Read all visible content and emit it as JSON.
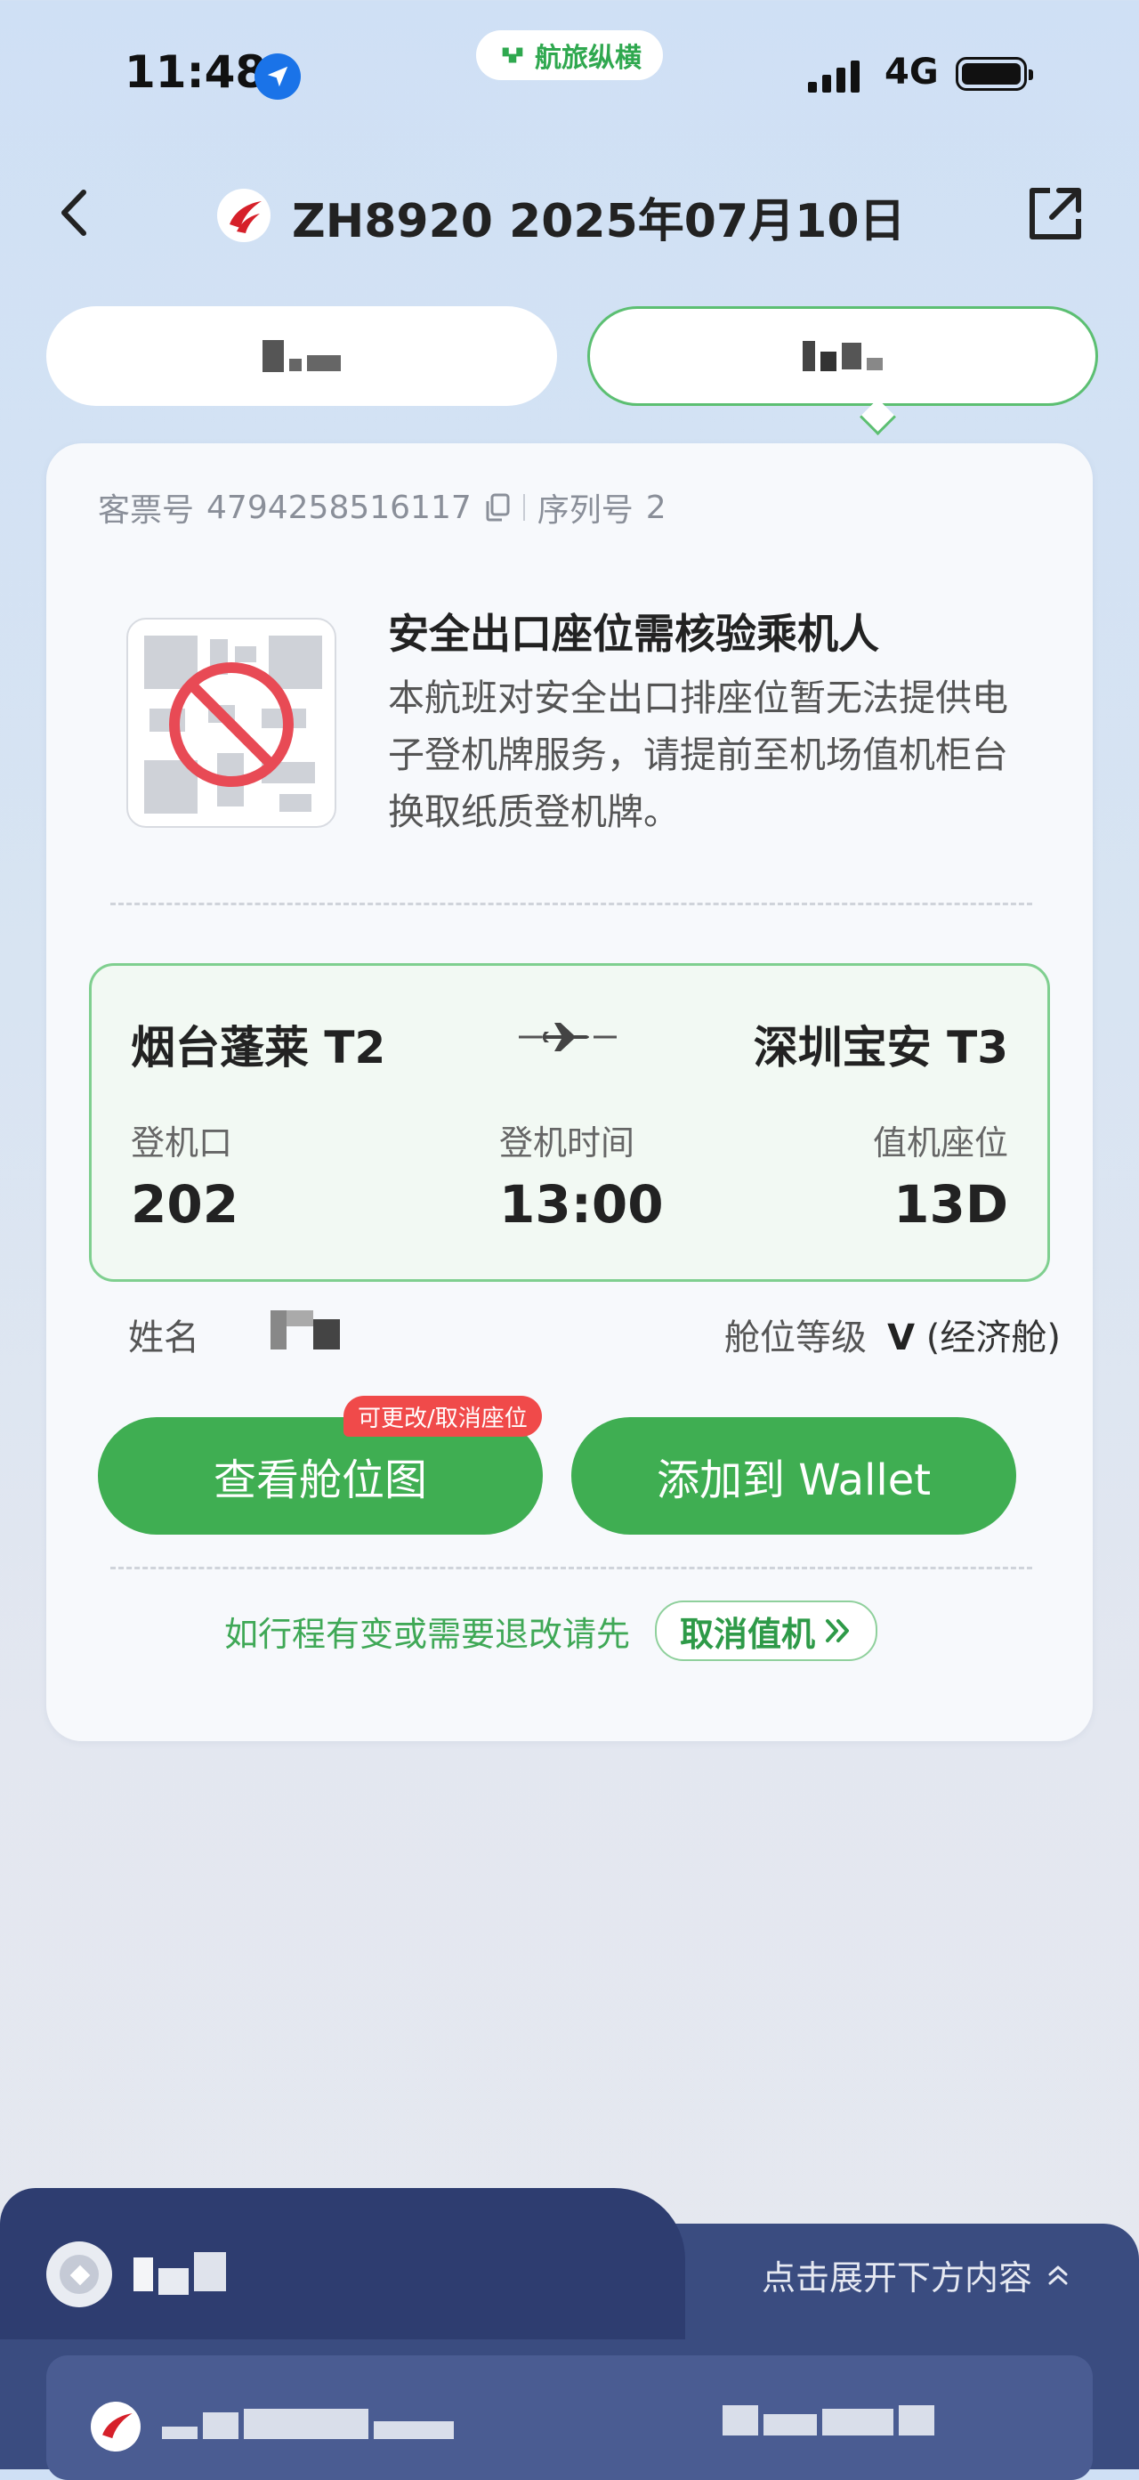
{
  "status_bar": {
    "time": "11:48",
    "app_badge": "航旅纵横",
    "network": "4G",
    "icons": [
      "location-arrow-icon",
      "signal-icon",
      "battery-icon"
    ]
  },
  "nav": {
    "title": "ZH8920 2025年07月10日",
    "back_icon": "chevron-left-icon",
    "share_icon": "share-external-icon"
  },
  "tabs": [
    {
      "label": "",
      "selected": false
    },
    {
      "label": "",
      "selected": true
    }
  ],
  "ticket": {
    "ticket_label": "客票号",
    "ticket_number": "4794258516117",
    "sequence_label": "序列号",
    "sequence_number": "2"
  },
  "notice": {
    "title": "安全出口座位需核验乘机人",
    "body": "本航班对安全出口排座位暂无法提供电子登机牌服务，请提前至机场值机柜台换取纸质登机牌。"
  },
  "route": {
    "from": "烟台蓬莱 T2",
    "to": "深圳宝安 T3",
    "gate_label": "登机口",
    "gate": "202",
    "boarding_label": "登机时间",
    "boarding_time": "13:00",
    "seat_label": "值机座位",
    "seat": "13D"
  },
  "passenger": {
    "name_label": "姓名",
    "name": "",
    "class_label": "舱位等级",
    "class_code": "V",
    "class_name": "(经济舱)"
  },
  "actions": {
    "seat_map": "查看舱位图",
    "seat_badge": "可更改/取消座位",
    "wallet": "添加到 Wallet",
    "note": "如行程有变或需要退改请先",
    "cancel_checkin": "取消值机"
  },
  "drawer": {
    "expand_label": "点击展开下方内容"
  },
  "colors": {
    "accent_green": "#3fae52",
    "badge_red": "#f04a4a",
    "drawer_navy": "#2e3d70"
  }
}
